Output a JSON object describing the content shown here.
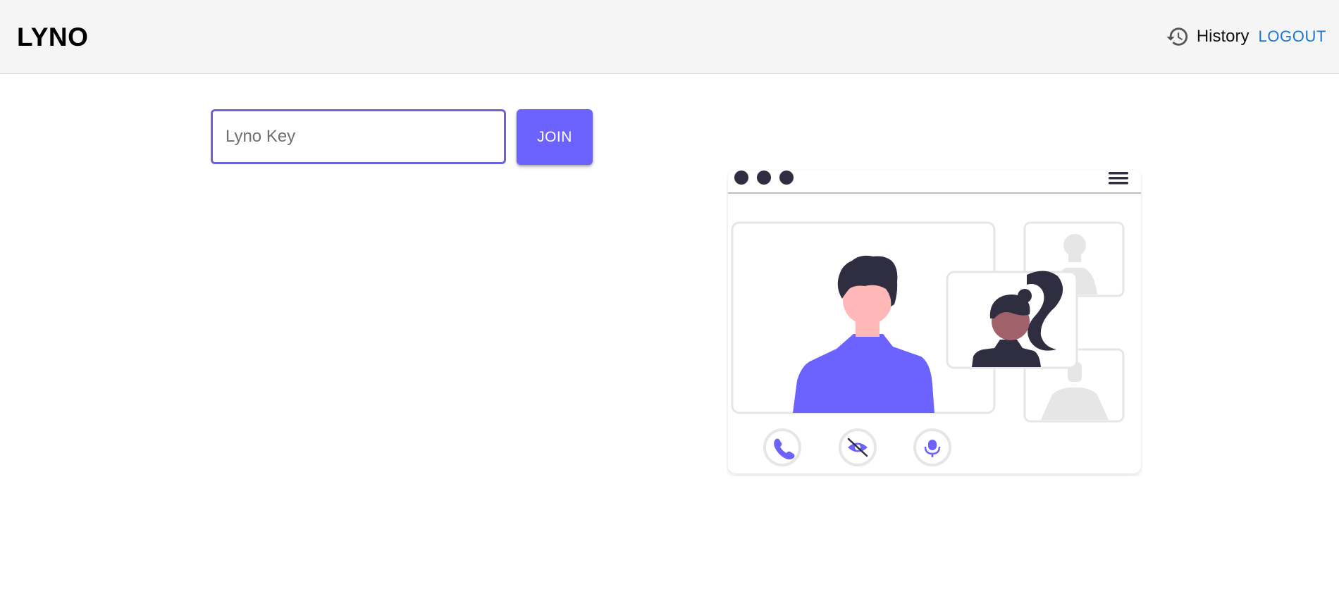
{
  "app_bar": {
    "brand": "LYNO",
    "history_label": "History",
    "logout_label": "LOGOUT"
  },
  "join_form": {
    "key_placeholder": "Lyno Key",
    "key_value": "",
    "join_label": "JOIN"
  },
  "colors": {
    "accent": "#6c63ff",
    "input_border": "#6c63d8",
    "link": "#1976d2",
    "app_bar_bg": "#f5f5f5",
    "illustration_dark": "#2f2e41",
    "skin_light": "#ffb8b8",
    "skin_dark": "#a0616a",
    "frame_gray": "#e6e6e6"
  },
  "icons": {
    "history": "history-icon",
    "illustration_controls": [
      "phone-icon",
      "eye-off-icon",
      "microphone-icon"
    ],
    "window_menu": "hamburger-menu-icon"
  }
}
